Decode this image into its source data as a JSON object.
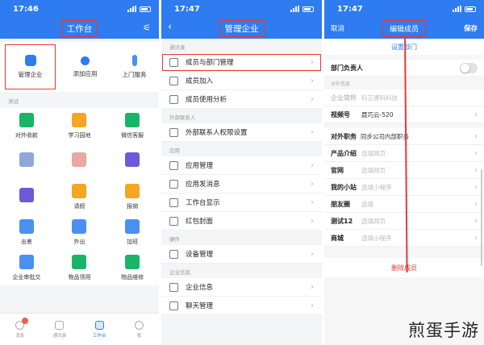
{
  "panel1": {
    "time": "17:46",
    "title": "工作台",
    "nav_icon": "settings-icon",
    "admin_items": [
      "管理企业",
      "添加应用",
      "上门服务"
    ],
    "section": "测试",
    "apps": [
      {
        "label": "对外收款",
        "color": "#18b566"
      },
      {
        "label": "学习园地",
        "color": "#f5a623"
      },
      {
        "label": "微信客服",
        "color": "#18b566"
      },
      {
        "label": "",
        "color": "#8fa8d8"
      },
      {
        "label": "",
        "color": "#e7a9a0"
      },
      {
        "label": "",
        "color": "#6b5bd9"
      },
      {
        "label": "",
        "color": "#6b5bd9"
      },
      {
        "label": "请假",
        "color": "#f5a623"
      },
      {
        "label": "报销",
        "color": "#f5a623"
      },
      {
        "label": "出差",
        "color": "#4a90f0"
      },
      {
        "label": "外出",
        "color": "#4a90f0"
      },
      {
        "label": "加班",
        "color": "#4a90f0"
      },
      {
        "label": "企业审批交",
        "color": "#4a90f0"
      },
      {
        "label": "物品领用",
        "color": "#18b566"
      },
      {
        "label": "物品维修",
        "color": "#18b566"
      }
    ],
    "tabs": [
      "消息",
      "通讯录",
      "工作台",
      "我"
    ]
  },
  "panel2": {
    "time": "17:47",
    "title": "管理企业",
    "groups": [
      {
        "label": "通讯录",
        "items": [
          "成员与部门管理",
          "成员加入",
          "成员使用分析"
        ]
      },
      {
        "label": "外部联系人",
        "items": [
          "外部联系人权限设置"
        ]
      },
      {
        "label": "应用",
        "items": [
          "应用管理",
          "应用发消息",
          "工作台显示",
          "红包封面"
        ]
      },
      {
        "label": "硬件",
        "items": [
          "设备管理"
        ]
      },
      {
        "label": "企业信息",
        "items": [
          "企业信息",
          "聊天管理"
        ]
      }
    ]
  },
  "panel3": {
    "time": "17:47",
    "cancel": "取消",
    "title": "编辑成员",
    "save": "保存",
    "set_dept": "设置部门",
    "dept_head": "部门负责人",
    "external_label": "对外信息",
    "company_key": "企业简称",
    "company_value": "科正建科科技",
    "video_key": "视频号",
    "video_value": "聂巧云-520",
    "fields": [
      {
        "k": "对外职务",
        "v": "同步公司内部职务",
        "dark": true,
        "wide": true
      },
      {
        "k": "产品介绍",
        "v": "选填网页",
        "dark": false,
        "wide": false
      },
      {
        "k": "官网",
        "v": "选填网页",
        "dark": false,
        "wide": false
      },
      {
        "k": "我的小站",
        "v": "选填小程序",
        "dark": false,
        "wide": false
      },
      {
        "k": "朋友圈",
        "v": "选填",
        "dark": false,
        "wide": false
      },
      {
        "k": "测试12",
        "v": "选填网页",
        "dark": false,
        "wide": false
      },
      {
        "k": "商城",
        "v": "选填小程序",
        "dark": false,
        "wide": false
      }
    ],
    "delete": "删除成员"
  },
  "watermark": "煎蛋手游",
  "colors": {
    "accent": "#2f7bf0",
    "highlight": "#e53935"
  }
}
